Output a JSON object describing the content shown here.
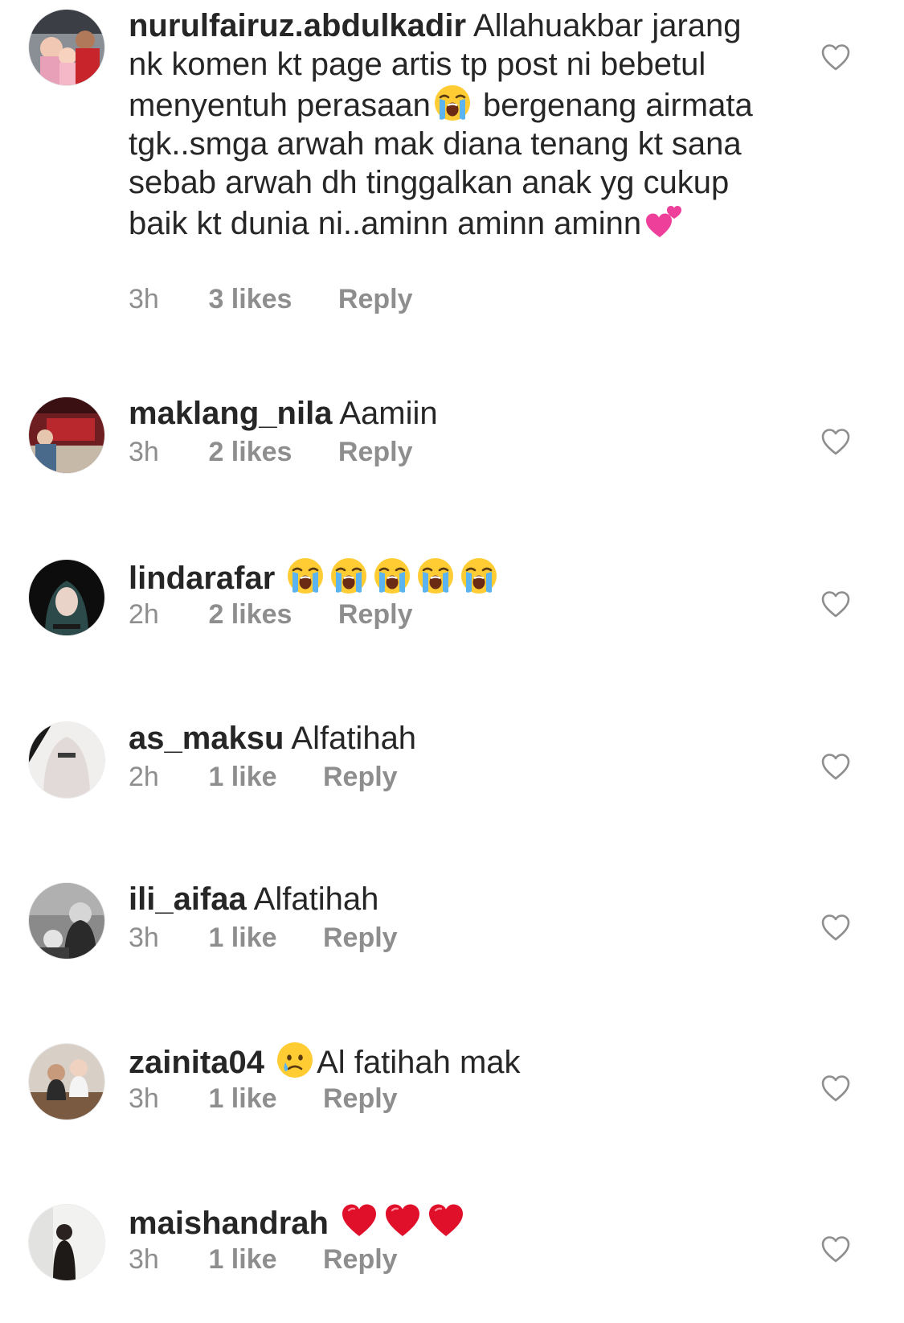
{
  "colors": {
    "text": "#262626",
    "meta": "#8e8e8e",
    "heart_outline": "#8e8e8e",
    "red_heart": "#e0102b",
    "pink_hearts": "#ee3f9a"
  },
  "comments": [
    {
      "username": "nurulfairuz.abdulkadir",
      "text_a": "Allahuakbar jarang nk komen kt page artis tp post ni bebetul menyentuh perasaan",
      "emoji_a": "loudly-crying-face",
      "text_b": "bergenang airmata tgk..smga arwah mak diana tenang kt sana sebab arwah dh tinggalkan anak yg cukup baik kt dunia ni..aminn aminn aminn",
      "emoji_b": "two-hearts",
      "time": "3h",
      "likes": "3 likes",
      "reply": "Reply"
    },
    {
      "username": "maklang_nila",
      "text": "Aamiin",
      "time": "3h",
      "likes": "2 likes",
      "reply": "Reply"
    },
    {
      "username": "lindarafar",
      "emoji": "loudly-crying-face",
      "emoji_count": 5,
      "time": "2h",
      "likes": "2 likes",
      "reply": "Reply"
    },
    {
      "username": "as_maksu",
      "text": "Alfatihah",
      "time": "2h",
      "likes": "1 like",
      "reply": "Reply"
    },
    {
      "username": "ili_aifaa",
      "text": "Alfatihah",
      "time": "3h",
      "likes": "1 like",
      "reply": "Reply"
    },
    {
      "username": "zainita04",
      "emoji": "crying-face",
      "text": "Al fatihah mak",
      "time": "3h",
      "likes": "1 like",
      "reply": "Reply"
    },
    {
      "username": "maishandrah",
      "emoji": "red-heart",
      "emoji_count": 3,
      "time": "3h",
      "likes": "1 like",
      "reply": "Reply"
    }
  ],
  "icons": {
    "like": "heart-outline-icon"
  }
}
